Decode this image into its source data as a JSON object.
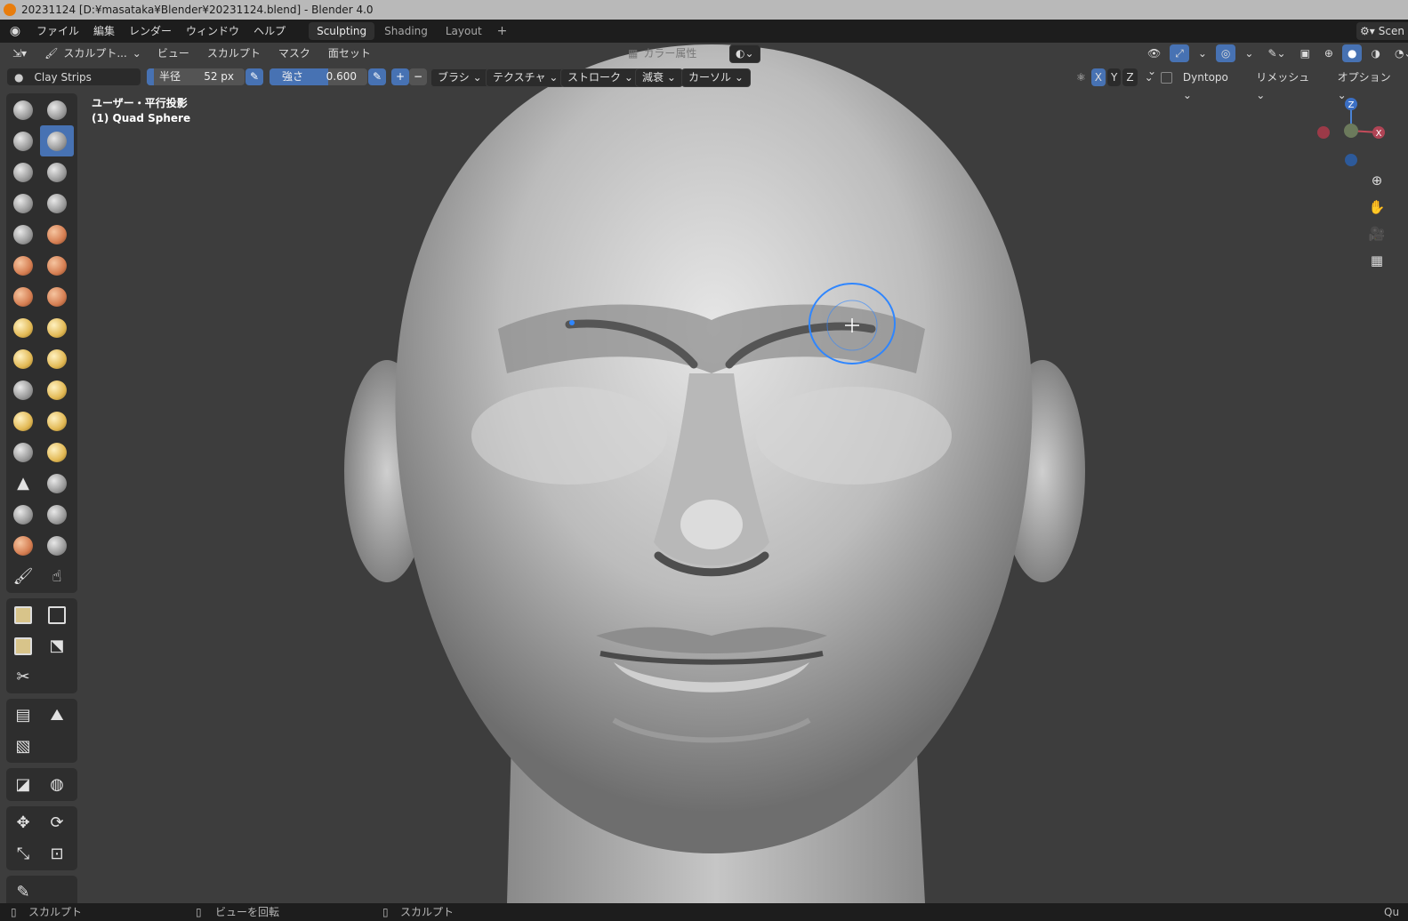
{
  "window": {
    "title": "20231124 [D:¥masataka¥Blender¥20231124.blend] - Blender 4.0"
  },
  "menu": {
    "file": "ファイル",
    "edit": "編集",
    "render": "レンダー",
    "window": "ウィンドウ",
    "help": "ヘルプ"
  },
  "workspaces": [
    {
      "label": "Sculpting",
      "active": true
    },
    {
      "label": "Shading"
    },
    {
      "label": "Layout"
    }
  ],
  "workspace_add": "+",
  "scene_label": "Scen",
  "header": {
    "mode": "スカルプト...",
    "view": "ビュー",
    "sculpt": "スカルプト",
    "mask": "マスク",
    "face_sets": "面セット",
    "color_attribute": "カラー属性"
  },
  "tool": {
    "brush_name": "Clay Strips",
    "radius_label": "半径",
    "radius_value": "52 px",
    "strength_label": "強さ",
    "strength_value": "0.600",
    "strength_fraction": 0.6,
    "add": "+",
    "subtract": "−",
    "brush": "ブラシ",
    "texture": "テクスチャ",
    "stroke": "ストローク",
    "falloff": "減衰",
    "cursor": "カーソル",
    "axis_x": "X",
    "axis_y": "Y",
    "axis_z": "Z",
    "dyntopo": "Dyntopo",
    "remesh": "リメッシュ",
    "options": "オプション"
  },
  "viewport": {
    "view_name": "ユーザー・平行投影",
    "object_name": "(1) Quad Sphere",
    "gizmo": {
      "z": "Z",
      "x": "X"
    },
    "accent": "#4772b3"
  },
  "status": {
    "left": "スカルプト",
    "middle": "ビューを回転",
    "right": "スカルプト",
    "far_right": "Qu"
  }
}
